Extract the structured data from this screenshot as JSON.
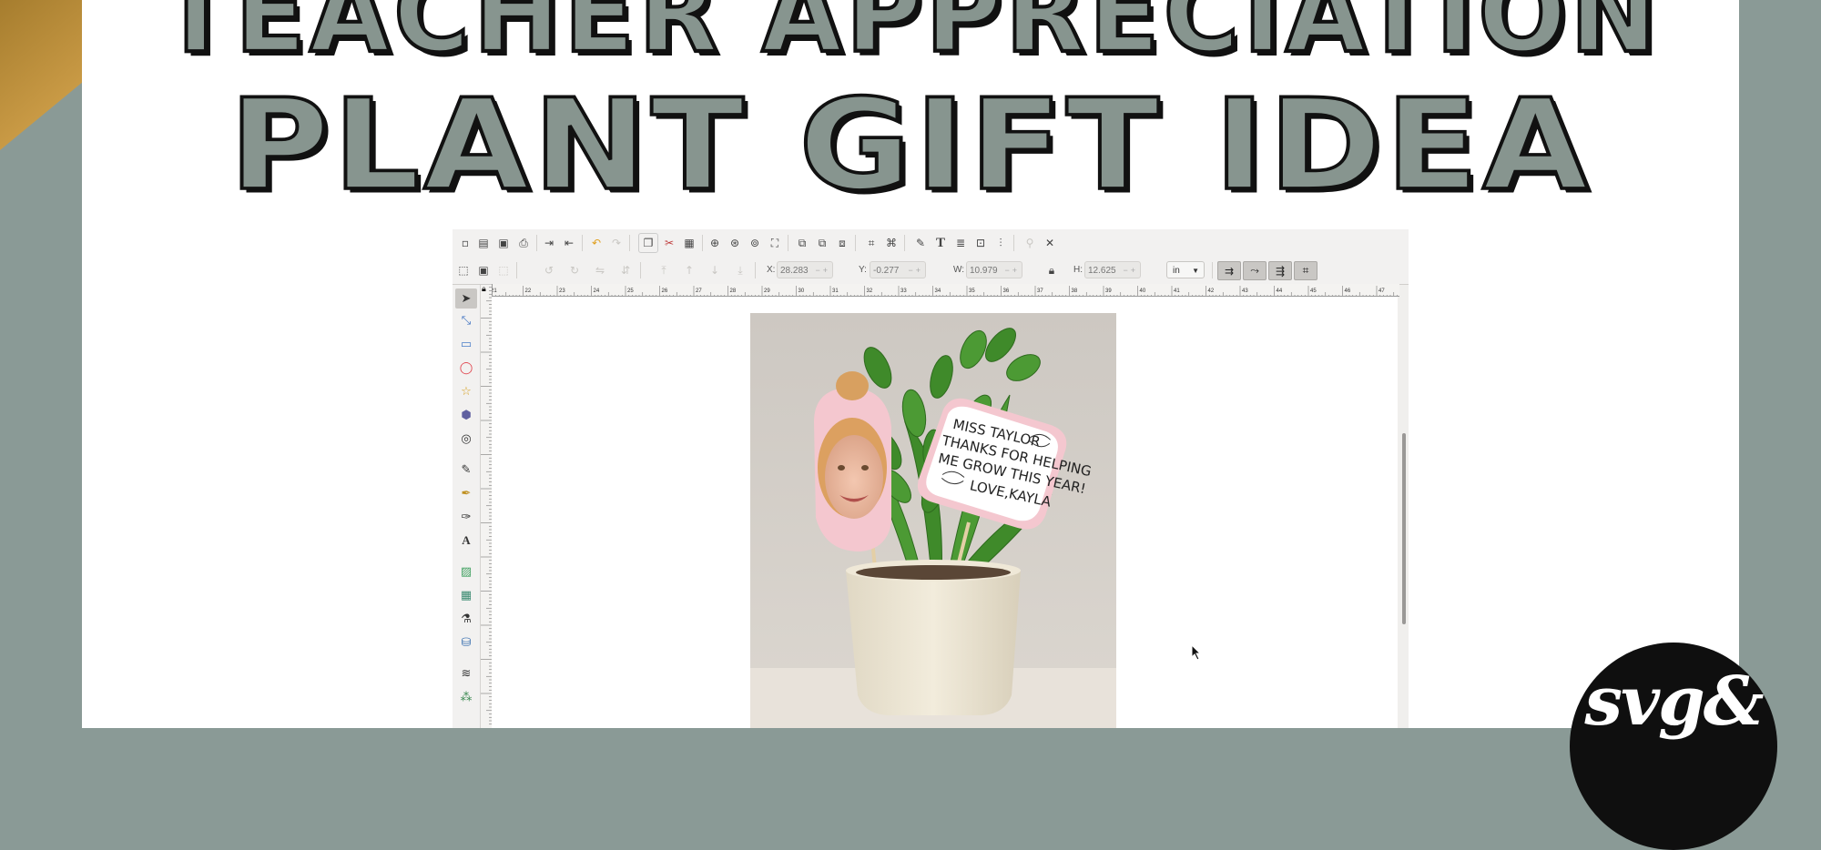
{
  "header": {
    "title_line1": "TEACHER APPRECIATION",
    "title_line2": "PLANT GIFT IDEA"
  },
  "colors": {
    "background": "#8a9a96",
    "title_fill": "#87958f",
    "title_outline": "#111111",
    "card": "#ffffff",
    "gold_accent": "#b08a3a"
  },
  "inkscape": {
    "toolbar_icons": [
      "new-icon",
      "open-icon",
      "save-icon",
      "print-icon",
      "import-icon",
      "export-icon",
      "undo-icon",
      "redo-icon",
      "copy-icon",
      "cut-icon",
      "paste-icon",
      "zoom-selection-icon",
      "zoom-drawing-icon",
      "zoom-page-icon",
      "zoom-fit-icon",
      "duplicate-icon",
      "clone-icon",
      "unlink-clone-icon",
      "group-icon",
      "ungroup-icon",
      "fill-stroke-icon",
      "text-font-icon",
      "layers-icon",
      "xml-editor-icon",
      "align-icon",
      "preferences-icon",
      "document-properties-icon"
    ],
    "selection_toolbar": {
      "x_label": "X:",
      "x_value": "28.283",
      "y_label": "Y:",
      "y_value": "-0.277",
      "w_label": "W:",
      "w_value": "10.979",
      "h_label": "H:",
      "h_value": "12.625",
      "unit": "in"
    },
    "tools": [
      "selector-tool-icon",
      "node-tool-icon",
      "rectangle-tool-icon",
      "ellipse-tool-icon",
      "star-tool-icon",
      "3d-box-tool-icon",
      "spiral-tool-icon",
      "pencil-tool-icon",
      "pen-tool-icon",
      "calligraphy-tool-icon",
      "text-tool-icon",
      "gradient-tool-icon",
      "mesh-tool-icon",
      "dropper-tool-icon",
      "paint-bucket-tool-icon",
      "tweak-tool-icon",
      "spray-tool-icon"
    ],
    "ruler_labels": [
      "21",
      "22",
      "23",
      "24",
      "25",
      "26",
      "27",
      "28",
      "29",
      "30",
      "31",
      "32",
      "33",
      "34",
      "35",
      "36",
      "37",
      "38",
      "39",
      "40",
      "41",
      "42",
      "43",
      "44",
      "45",
      "46",
      "47"
    ]
  },
  "sticker": {
    "lines": [
      "MISS TAYLOR",
      "THANKS FOR HELPING",
      "ME GROW THIS YEAR!",
      "LOVE,KAYLA"
    ]
  },
  "badge": {
    "text": "svg&"
  }
}
